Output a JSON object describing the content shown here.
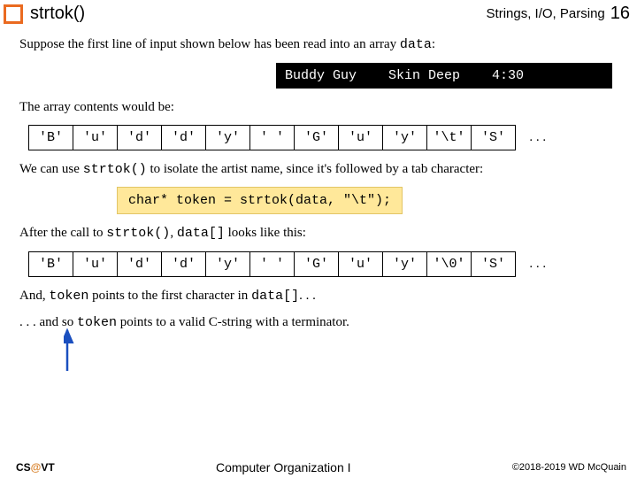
{
  "header": {
    "title": "strtok()",
    "topic": "Strings, I/O, Parsing",
    "slide_num": "16"
  },
  "p1_a": "Suppose the first line of input shown below has been read into an array ",
  "p1_b": "data",
  "p1_c": ":",
  "black_line": "Buddy Guy    Skin Deep    4:30",
  "p2": "The array contents would be:",
  "arr1": [
    "'B'",
    "'u'",
    "'d'",
    "'d'",
    "'y'",
    "' '",
    "'G'",
    "'u'",
    "'y'",
    "'\\t'",
    "'S'"
  ],
  "ellipsis": ". . .",
  "p3_a": "We can use ",
  "p3_b": "strtok()",
  "p3_c": " to isolate the artist name, since it's followed by a tab character:",
  "code1": "char* token = strtok(data, \"\\t\");",
  "p4_a": "After the call to ",
  "p4_b": "strtok()",
  "p4_c": ", ",
  "p4_d": "data[]",
  "p4_e": " looks like this:",
  "arr2": [
    "'B'",
    "'u'",
    "'d'",
    "'d'",
    "'y'",
    "' '",
    "'G'",
    "'u'",
    "'y'",
    "'\\0'",
    "'S'"
  ],
  "p5_a": "And, ",
  "p5_b": "token",
  "p5_c": " points to the first character in ",
  "p5_d": "data[]",
  "p5_e": ". . .",
  "p6_a": ". . . and so ",
  "p6_b": "token",
  "p6_c": " points to a valid C-string with a terminator.",
  "footer": {
    "cs": "CS",
    "at": "@",
    "vt": "VT",
    "course": "Computer Organization I",
    "copy": "©2018-2019 WD McQuain"
  }
}
